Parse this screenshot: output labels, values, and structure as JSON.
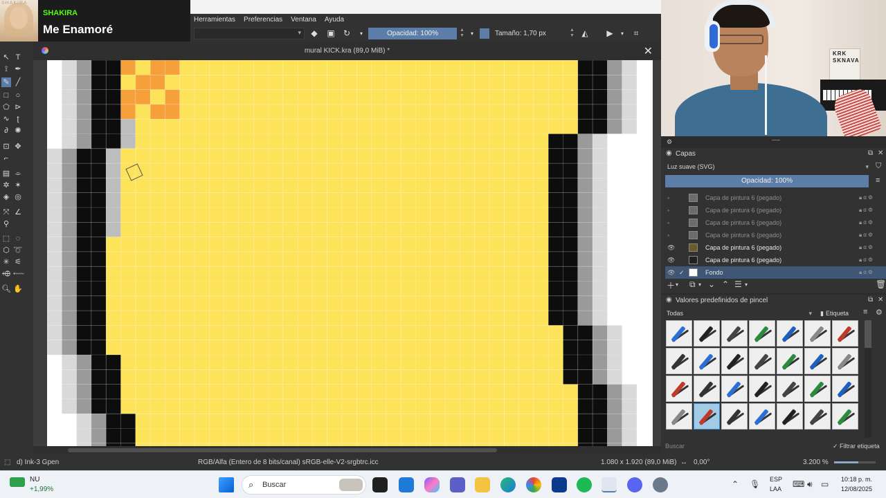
{
  "music": {
    "artist": "SHAKIRA",
    "title": "Me Enamoré",
    "album_text": "SHAKIRA"
  },
  "menu": [
    "Herramientas",
    "Preferencias",
    "Ventana",
    "Ayuda"
  ],
  "toolbar": {
    "opacity_label": "Opacidad: 100%",
    "size_label": "Tamaño: 1,70 px"
  },
  "document": {
    "title": "mural KICK.kra (89,0 MiB) *"
  },
  "status": {
    "brush": "d) Ink-3 Gpen",
    "color_space": "RGB/Alfa (Entero de 8 bits/canal)  sRGB-elle-V2-srgbtrc.icc",
    "dimensions": "1.080 x 1.920 (89,0 MiB)",
    "rotation": "0,00°",
    "zoom": "3.200 %"
  },
  "webcam": {
    "poster_line1": "KRK",
    "poster_line2": "SKNAVA"
  },
  "layers": {
    "title": "Capas",
    "blend_mode": "Luz suave (SVG)",
    "opacity": "Opacidad:  100%",
    "items": [
      {
        "name": "Capa de pintura 6 (pegado)",
        "visible": false
      },
      {
        "name": "Capa de pintura 6 (pegado)",
        "visible": false
      },
      {
        "name": "Capa de pintura 6 (pegado)",
        "visible": false
      },
      {
        "name": "Capa de pintura 6 (pegado)",
        "visible": false
      },
      {
        "name": "Capa de pintura 6 (pegado)",
        "visible": true
      },
      {
        "name": "Capa de pintura 6 (pegado)",
        "visible": true
      },
      {
        "name": "Fondo",
        "visible": true,
        "selected": true
      }
    ]
  },
  "brushes": {
    "title": "Valores predefinidos de pincel",
    "filter": "Todas",
    "tag_label": "Etiqueta",
    "search_placeholder": "Buscar",
    "filter_tag_label": "Filtrar etiqueta"
  },
  "taskbar": {
    "stock_label": "NU",
    "stock_change": "+1,99%",
    "search_label": "Buscar",
    "lang1": "ESP",
    "lang2": "LAA",
    "time": "10:18 p. m.",
    "date": "12/08/2025"
  },
  "colors": {
    "accent": "#5b7da8",
    "canvas_yellow": "#fde35a",
    "canvas_orange": "#f6a03c",
    "kick_green": "#53fc18"
  }
}
